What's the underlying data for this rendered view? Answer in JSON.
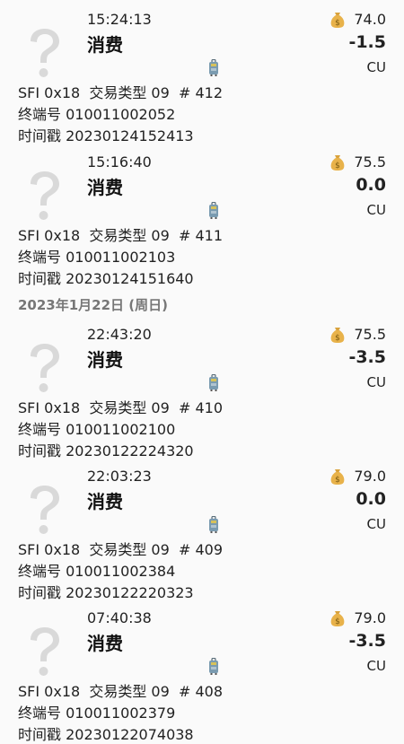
{
  "date_header": "2023年1月22日 (周日)",
  "transactions": [
    {
      "time": "15:24:13",
      "type": "消费",
      "balance": "74.0",
      "amount": "-1.5",
      "currency": "CU",
      "line1": "SFI 0x18  交易类型 09  # 412",
      "line2": "终端号 010011002052",
      "line3": "时间戳 20230124152413"
    },
    {
      "time": "15:16:40",
      "type": "消费",
      "balance": "75.5",
      "amount": "0.0",
      "currency": "CU",
      "line1": "SFI 0x18  交易类型 09  # 411",
      "line2": "终端号 010011002103",
      "line3": "时间戳 20230124151640"
    },
    {
      "time": "22:43:20",
      "type": "消费",
      "balance": "75.5",
      "amount": "-3.5",
      "currency": "CU",
      "line1": "SFI 0x18  交易类型 09  # 410",
      "line2": "终端号 010011002100",
      "line3": "时间戳 20230122224320"
    },
    {
      "time": "22:03:23",
      "type": "消费",
      "balance": "79.0",
      "amount": "0.0",
      "currency": "CU",
      "line1": "SFI 0x18  交易类型 09  # 409",
      "line2": "终端号 010011002384",
      "line3": "时间戳 20230122220323"
    },
    {
      "time": "07:40:38",
      "type": "消费",
      "balance": "79.0",
      "amount": "-3.5",
      "currency": "CU",
      "line1": "SFI 0x18  交易类型 09  # 408",
      "line2": "终端号 010011002379",
      "line3": "时间戳 20230122074038"
    }
  ],
  "icons": {
    "unknown": "question-mark-icon",
    "balance": "money-bag-icon",
    "luggage": "luggage-icon"
  }
}
